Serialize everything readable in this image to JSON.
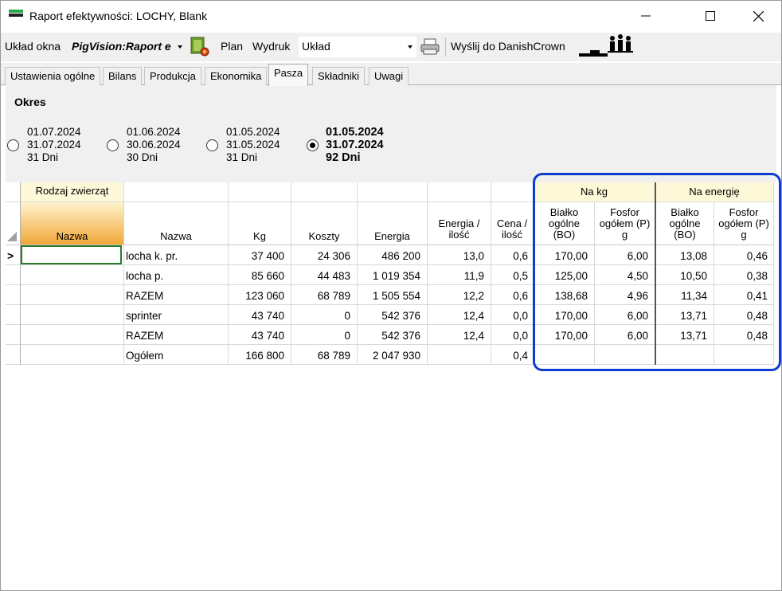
{
  "window": {
    "title": "Raport efektywności: LOCHY, Blank",
    "controls": [
      "minimize",
      "maximize",
      "close"
    ]
  },
  "toolbar": {
    "layout_label": "Układ okna",
    "report_name": "PigVision:Raport e",
    "plan_label": "Plan",
    "print_label": "Wydruk",
    "layout_dropdown_value": "Układ",
    "send_label": "Wyślij do DanishCrown"
  },
  "tabs": [
    {
      "label": "Ustawienia ogólne",
      "active": false
    },
    {
      "label": "Bilans",
      "active": false
    },
    {
      "label": "Produkcja",
      "active": false
    },
    {
      "label": "Ekonomika",
      "active": false
    },
    {
      "label": "Pasza",
      "active": true
    },
    {
      "label": "Składniki",
      "active": false
    },
    {
      "label": "Uwagi",
      "active": false
    }
  ],
  "period": {
    "title": "Okres",
    "options": [
      {
        "from": "01.07.2024",
        "to": "31.07.2024",
        "days": "31 Dni",
        "selected": false
      },
      {
        "from": "01.06.2024",
        "to": "30.06.2024",
        "days": "30 Dni",
        "selected": false
      },
      {
        "from": "01.05.2024",
        "to": "31.05.2024",
        "days": "31 Dni",
        "selected": false
      },
      {
        "from": "01.05.2024",
        "to": "31.07.2024",
        "days": "92 Dni",
        "selected": true
      }
    ]
  },
  "grid": {
    "group_headers": {
      "animal_type": "Rodzaj zwierząt",
      "per_kg": "Na kg",
      "per_energy": "Na energię"
    },
    "columns": {
      "left_name": "Nazwa",
      "name": "Nazwa",
      "kg": "Kg",
      "costs": "Koszty",
      "energy": "Energia",
      "energy_qty_1": "Energia /",
      "energy_qty_2": "ilość",
      "price_qty_1": "Cena /",
      "price_qty_2": "ilość",
      "protein_1": "Białko",
      "protein_2": "ogólne",
      "protein_3": "(BO)",
      "phosphor_1": "Fosfor",
      "phosphor_2": "ogółem (P)",
      "phosphor_3": "g"
    },
    "row_indicator": ">",
    "rows": [
      {
        "name": "locha k. pr.",
        "kg": "37 400",
        "costs": "24 306",
        "energy": "486 200",
        "energy_qty": "13,0",
        "price_qty": "0,6",
        "kg_protein": "170,00",
        "kg_phosphor": "6,00",
        "en_protein": "13,08",
        "en_phosphor": "0,46"
      },
      {
        "name": "locha p.",
        "kg": "85 660",
        "costs": "44 483",
        "energy": "1 019 354",
        "energy_qty": "11,9",
        "price_qty": "0,5",
        "kg_protein": "125,00",
        "kg_phosphor": "4,50",
        "en_protein": "10,50",
        "en_phosphor": "0,38"
      },
      {
        "name": "RAZEM",
        "kg": "123 060",
        "costs": "68 789",
        "energy": "1 505 554",
        "energy_qty": "12,2",
        "price_qty": "0,6",
        "kg_protein": "138,68",
        "kg_phosphor": "4,96",
        "en_protein": "11,34",
        "en_phosphor": "0,41"
      },
      {
        "name": "sprinter",
        "kg": "43 740",
        "costs": "0",
        "energy": "542 376",
        "energy_qty": "12,4",
        "price_qty": "0,0",
        "kg_protein": "170,00",
        "kg_phosphor": "6,00",
        "en_protein": "13,71",
        "en_phosphor": "0,48"
      },
      {
        "name": "RAZEM",
        "kg": "43 740",
        "costs": "0",
        "energy": "542 376",
        "energy_qty": "12,4",
        "price_qty": "0,0",
        "kg_protein": "170,00",
        "kg_phosphor": "6,00",
        "en_protein": "13,71",
        "en_phosphor": "0,48"
      },
      {
        "name": "Ogółem",
        "kg": "166 800",
        "costs": "68 789",
        "energy": "2 047 930",
        "energy_qty": "",
        "price_qty": "0,4",
        "kg_protein": "",
        "kg_phosphor": "",
        "en_protein": "",
        "en_phosphor": ""
      }
    ]
  },
  "colors": {
    "group_header_bg": "#fdf8d8",
    "left_header_gradient_top": "#fff4d0",
    "left_header_gradient_bottom": "#f0a838",
    "selection_frame": "#0a3ccf",
    "active_cell_border": "#2a7a2a"
  }
}
